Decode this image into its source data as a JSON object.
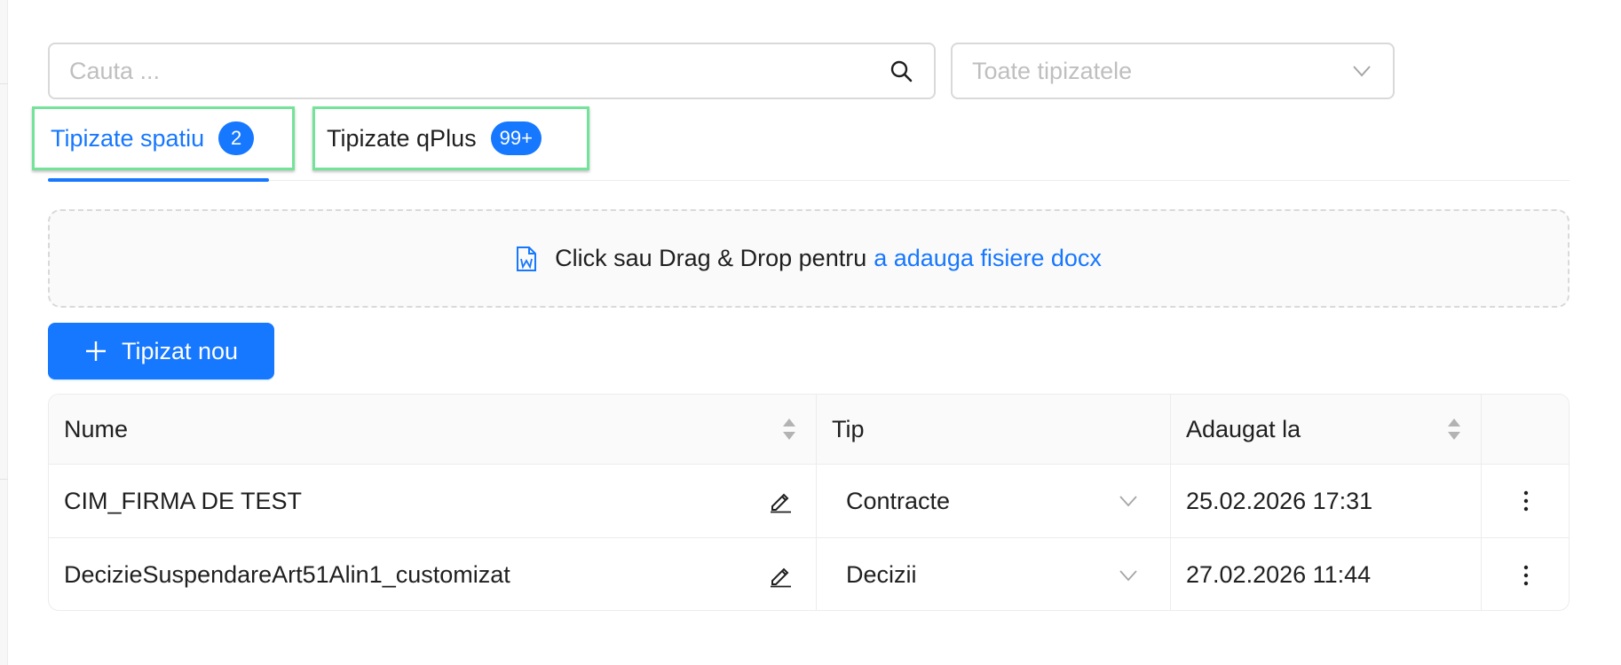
{
  "search": {
    "placeholder": "Cauta ..."
  },
  "filter_select": {
    "placeholder": "Toate tipizatele"
  },
  "tabs": [
    {
      "label": "Tipizate spatiu",
      "badge": "2"
    },
    {
      "label": "Tipizate qPlus",
      "badge": "99+"
    }
  ],
  "dropzone": {
    "text": "Click sau Drag & Drop pentru",
    "link": "a adauga fisiere docx"
  },
  "new_button": {
    "label": "Tipizat nou"
  },
  "table": {
    "columns": [
      "Nume",
      "Tip",
      "Adaugat la"
    ],
    "rows": [
      {
        "name": "CIM_FIRMA DE TEST",
        "tip": "Contracte",
        "date": "25.02.2026 17:31"
      },
      {
        "name": "DecizieSuspendareArt51Alin1_customizat",
        "tip": "Decizii",
        "date": "27.02.2026 11:44"
      }
    ]
  },
  "colors": {
    "primary": "#1677ff",
    "highlight": "#74e39a",
    "border": "#d9d9d9"
  },
  "icons": {
    "search": "search-icon",
    "chevron": "chevron-down-icon",
    "word": "word-file-icon",
    "plus": "plus-icon",
    "edit": "edit-icon",
    "more": "more-vertical-icon",
    "sort": "sort-icon"
  }
}
